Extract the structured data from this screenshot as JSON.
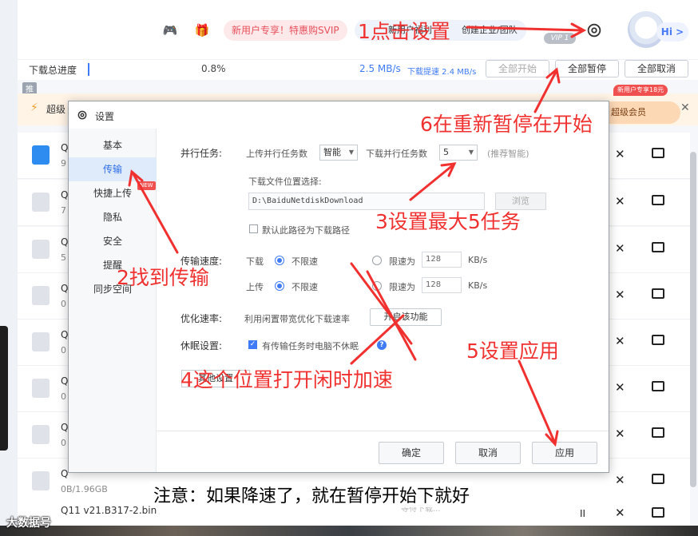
{
  "topbar": {
    "promo": "新用户专享！特惠购SVIP",
    "pill_left": "新用户福利",
    "pill_right": "创建企业/团队",
    "vip": "VIP 1",
    "hi": "Hi >"
  },
  "progress": {
    "label": "下载总进度",
    "percent_text": "0.8%",
    "percent_value": 0.008,
    "speed": "2.5 MB/s",
    "boost_speed": "下载提速 2.4 MB/s",
    "start_all": "全部开始",
    "pause_all": "全部暂停",
    "cancel_all": "全部取消"
  },
  "banner": {
    "tag": "推荐",
    "text": "超级",
    "vip_btn": "超级会员",
    "new_badge": "新用户专享18元"
  },
  "rows": [
    {
      "name": "Q",
      "size": "9"
    },
    {
      "name": "Q",
      "size": "7"
    },
    {
      "name": "Q",
      "size": "5"
    },
    {
      "name": "Q",
      "size": "0"
    },
    {
      "name": "Q",
      "size": "0"
    },
    {
      "name": "Q",
      "size": "0"
    },
    {
      "name": "Q",
      "size": "0"
    },
    {
      "name": "Q",
      "size": "0B/1.96GB"
    }
  ],
  "last_row": {
    "name": "Q11 v21.B317-2.bin",
    "status": "等待下载...",
    "pause": "II"
  },
  "dialog": {
    "title": "设置",
    "nav": [
      "基本",
      "传输",
      "快捷上传",
      "隐私",
      "安全",
      "提醒",
      "同步空间"
    ],
    "nav_new": "NEW",
    "parallel_label": "并行任务:",
    "upload_parallel": "上传并行任务数",
    "upload_value": "智能",
    "download_parallel": "下载并行任务数",
    "download_value": "5",
    "recommend": "(推荐智能)",
    "location_label": "下载文件位置选择:",
    "path": "D:\\BaiduNetdiskDownload",
    "browse": "浏览",
    "default_path": "默认此路径为下载路径",
    "speed_label": "传输速度:",
    "download": "下载",
    "upload": "上传",
    "unlimited": "不限速",
    "limit_to": "限速为",
    "limit_value_dl": "128",
    "limit_value_ul": "128",
    "unit": "KB/s",
    "optimize_label": "优化速率:",
    "optimize_text": "利用闲置带宽优化下载速率",
    "open_feature": "开启该功能",
    "sleep_label": "休眠设置:",
    "sleep_text": "有传输任务时电脑不休眠",
    "more_settings": "其他设置",
    "ok": "确定",
    "cancel": "取消",
    "apply": "应用"
  },
  "annotations": {
    "a1": "1点击设置",
    "a2": "2找到传输",
    "a3": "3设置最大5任务",
    "a4": "4这个位置打开闲时加速",
    "a5": "5设置应用",
    "a6": "6在重新暂停在开始",
    "note": "注意：如果降速了，就在暂停开始下就好"
  },
  "watermark": "大数据号",
  "colors": {
    "accent": "#3f7bf6",
    "annotation": "#f0312f"
  }
}
